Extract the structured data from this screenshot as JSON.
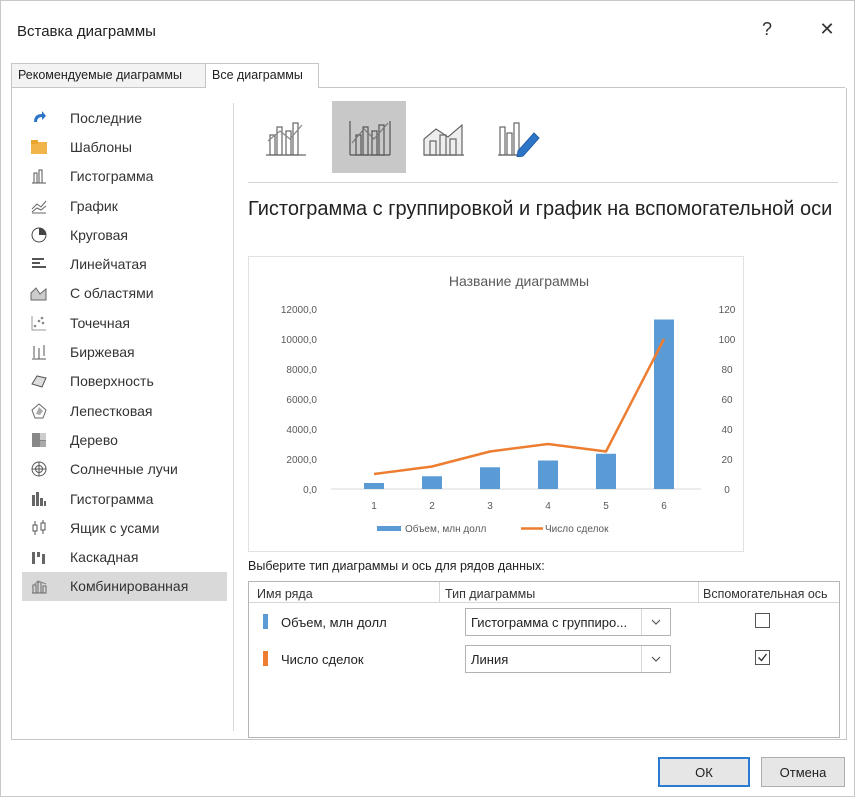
{
  "window": {
    "title": "Вставка диаграммы",
    "help": "?",
    "close": "✕"
  },
  "tabs": [
    "Рекомендуемые диаграммы",
    "Все диаграммы"
  ],
  "sidebar": {
    "items": [
      {
        "label": "Последние",
        "icon": "recent-icon"
      },
      {
        "label": "Шаблоны",
        "icon": "folder-icon"
      },
      {
        "label": "Гистограмма",
        "icon": "column-chart-icon"
      },
      {
        "label": "График",
        "icon": "line-chart-icon"
      },
      {
        "label": "Круговая",
        "icon": "pie-chart-icon"
      },
      {
        "label": "Линейчатая",
        "icon": "bar-chart-icon"
      },
      {
        "label": "С областями",
        "icon": "area-chart-icon"
      },
      {
        "label": "Точечная",
        "icon": "scatter-chart-icon"
      },
      {
        "label": "Биржевая",
        "icon": "stock-chart-icon"
      },
      {
        "label": "Поверхность",
        "icon": "surface-chart-icon"
      },
      {
        "label": "Лепестковая",
        "icon": "radar-chart-icon"
      },
      {
        "label": "Дерево",
        "icon": "treemap-chart-icon"
      },
      {
        "label": "Солнечные лучи",
        "icon": "sunburst-chart-icon"
      },
      {
        "label": "Гистограмма",
        "icon": "histogram-chart-icon"
      },
      {
        "label": "Ящик с усами",
        "icon": "box-whisker-chart-icon"
      },
      {
        "label": "Каскадная",
        "icon": "waterfall-chart-icon"
      },
      {
        "label": "Комбинированная",
        "icon": "combo-chart-icon",
        "selected": true
      }
    ]
  },
  "subtype_heading": "Гистограмма с группировкой и график на вспомогательной оси",
  "chart_data": {
    "type": "bar",
    "title": "Название диаграммы",
    "categories": [
      "1",
      "2",
      "3",
      "4",
      "5",
      "6"
    ],
    "series": [
      {
        "name": "Объем, млн долл",
        "type": "bar",
        "axis": "primary",
        "color": "#5b9bd5",
        "values": [
          400,
          850,
          1450,
          1900,
          2350,
          11300
        ]
      },
      {
        "name": "Число сделок",
        "type": "line",
        "axis": "secondary",
        "color": "#ed7d31",
        "values": [
          10,
          15,
          25,
          30,
          25,
          100
        ]
      }
    ],
    "y_primary": {
      "min": 0,
      "max": 12000,
      "ticks": [
        "0,0",
        "2000,0",
        "4000,0",
        "6000,0",
        "8000,0",
        "10000,0",
        "12000,0"
      ]
    },
    "y_secondary": {
      "min": 0,
      "max": 120,
      "ticks": [
        "0",
        "20",
        "40",
        "60",
        "80",
        "100",
        "120"
      ]
    },
    "grid": false,
    "legend": "bottom"
  },
  "series_panel": {
    "prompt": "Выберите тип диаграммы и ось для рядов данных:",
    "headers": {
      "name": "Имя ряда",
      "type": "Тип диаграммы",
      "secondary": "Вспомогательная ось"
    },
    "rows": [
      {
        "name": "Объем, млн долл",
        "type": "Гистограмма с группиро...",
        "secondary": false,
        "color": "#5b9bd5"
      },
      {
        "name": "Число сделок",
        "type": "Линия",
        "secondary": true,
        "color": "#ed7d31"
      }
    ]
  },
  "buttons": {
    "ok": "ОК",
    "cancel": "Отмена"
  }
}
